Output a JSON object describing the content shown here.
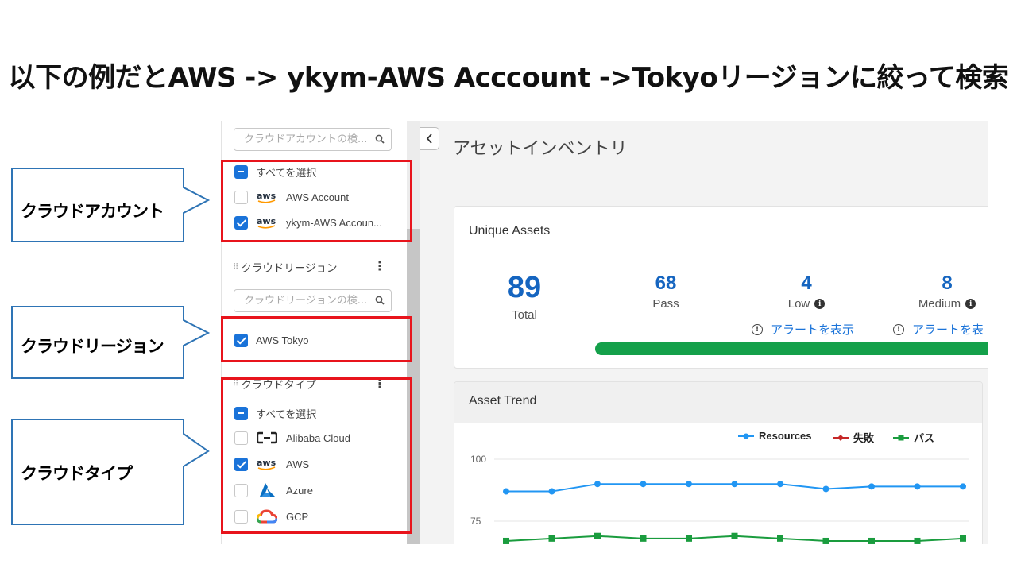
{
  "slide": {
    "title": "以下の例だとAWS -> ykym-AWS Acccount ->Tokyoリージョンに絞って検索",
    "callouts": [
      "クラウドアカウント",
      "クラウドリージョン",
      "クラウドタイプ"
    ],
    "highlight_color": "#e8141c",
    "callout_border_color": "#2e74b5"
  },
  "sidebar": {
    "account_search_placeholder": "クラウドアカウントの検...",
    "accounts": {
      "select_all": "すべてを選択",
      "items": [
        {
          "label": "AWS Account",
          "logo": "aws-logo",
          "checked": false
        },
        {
          "label": "ykym-AWS Accoun...",
          "logo": "aws-logo",
          "checked": true
        }
      ]
    },
    "region_section": {
      "title": "クラウドリージョン",
      "search_placeholder": "クラウドリージョンの検...",
      "items": [
        {
          "label": "AWS Tokyo",
          "checked": true
        }
      ]
    },
    "type_section": {
      "title": "クラウドタイプ",
      "select_all": "すべてを選択",
      "items": [
        {
          "label": "Alibaba Cloud",
          "logo": "alibaba-cloud-logo",
          "checked": false
        },
        {
          "label": "AWS",
          "logo": "aws-logo",
          "checked": true
        },
        {
          "label": "Azure",
          "logo": "azure-logo",
          "checked": false
        },
        {
          "label": "GCP",
          "logo": "gcp-logo",
          "checked": false
        }
      ]
    }
  },
  "main": {
    "page_title": "アセットインベントリ",
    "unique_assets": {
      "title": "Unique Assets",
      "total": {
        "value": "89",
        "label": "Total"
      },
      "pass": {
        "value": "68",
        "label": "Pass"
      },
      "low": {
        "value": "4",
        "label": "Low",
        "alert_link": "アラートを表示"
      },
      "medium": {
        "value": "8",
        "label": "Medium",
        "alert_link": "アラートを表"
      },
      "pass_bar_color": "#14a04a",
      "number_color": "#1565c0"
    },
    "asset_trend": {
      "title": "Asset Trend",
      "legend": {
        "resources": "Resources",
        "fail": "失敗",
        "pass": "パス"
      },
      "yticks": [
        "100",
        "75"
      ]
    }
  },
  "chart_data": {
    "type": "line",
    "title": "Asset Trend",
    "x": [
      1,
      2,
      3,
      4,
      5,
      6,
      7,
      8,
      9,
      10,
      11
    ],
    "ylim": [
      70,
      100
    ],
    "series": [
      {
        "name": "Resources",
        "color": "#2196f3",
        "values": [
          87,
          87,
          90,
          90,
          90,
          90,
          90,
          88,
          89,
          89,
          89
        ]
      },
      {
        "name": "パス",
        "color": "#1a9c3e",
        "values": [
          67,
          68,
          69,
          68,
          68,
          69,
          68,
          67,
          67,
          67,
          68
        ]
      }
    ],
    "legend_position": "top"
  }
}
